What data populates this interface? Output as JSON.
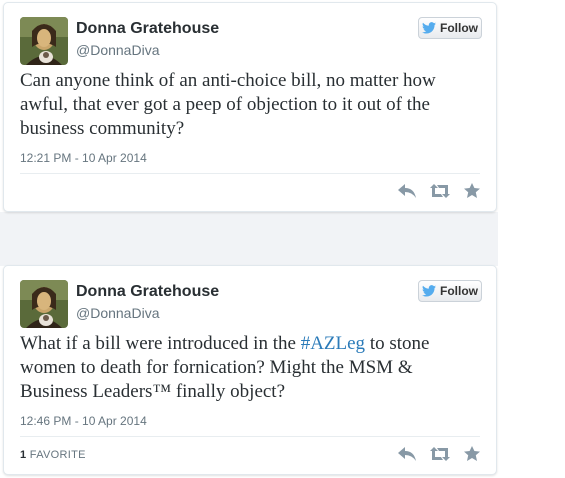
{
  "tweets": [
    {
      "author_name": "Donna Gratehouse",
      "author_handle": "@DonnaDiva",
      "follow_label": "Follow",
      "text": "Can anyone think of an anti-choice bill, no matter how awful, that ever got a peep of objection to it out of the business community?",
      "timestamp": "12:21 PM - 10 Apr 2014",
      "icons": [
        "reply-icon",
        "retweet-icon",
        "favorite-icon"
      ]
    },
    {
      "author_name": "Donna Gratehouse",
      "author_handle": "@DonnaDiva",
      "follow_label": "Follow",
      "text_before": "What if a bill were introduced in the ",
      "hashtag": "#AZLeg",
      "text_after": " to stone women to death for fornication? Might the MSM & Business Leaders™ finally object?",
      "timestamp": "12:46 PM - 10 Apr 2014",
      "favorite_count": "1",
      "favorite_label": "FAVORITE",
      "icons": [
        "reply-icon",
        "retweet-icon",
        "favorite-icon"
      ]
    }
  ],
  "colors": {
    "text": "#292f33",
    "muted": "#66757f",
    "hashtag": "#2b7bb9",
    "twitter_blue": "#55acee",
    "icon_gray": "#9aa5ad"
  }
}
